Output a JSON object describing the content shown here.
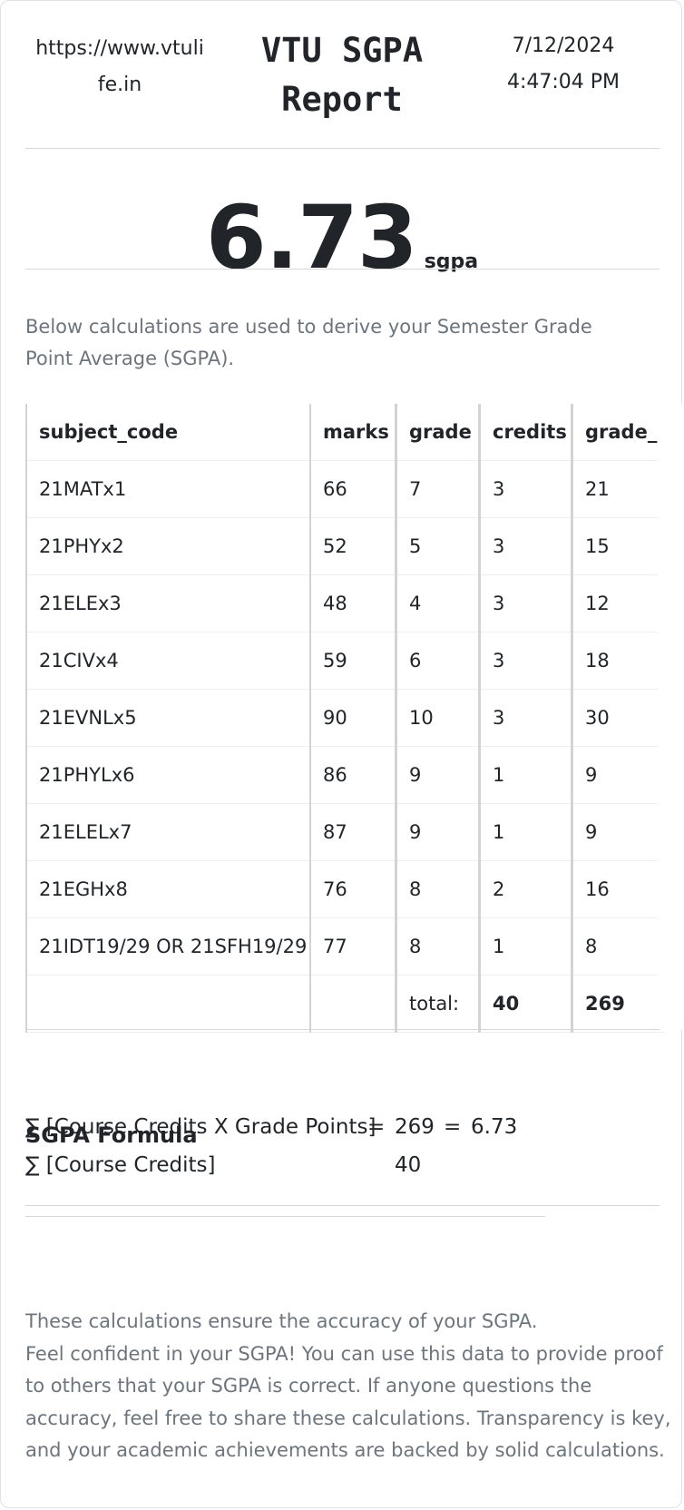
{
  "header": {
    "site_line1": "https://www.vtuli",
    "site_line2": "fe.in",
    "title_line1": "VTU SGPA",
    "title_line2": "Report",
    "date": "7/12/2024",
    "time": "4:47:04 PM"
  },
  "result": {
    "sgpa": "6.73",
    "unit": "sgpa"
  },
  "description": "Below calculations are used to derive your Semester Grade Point Average (SGPA).",
  "table": {
    "headers": [
      "subject_code",
      "marks",
      "grade",
      "credits",
      "grade_x_credits"
    ],
    "rows": [
      [
        "21MATx1",
        "66",
        "7",
        "3",
        "21"
      ],
      [
        "21PHYx2",
        "52",
        "5",
        "3",
        "15"
      ],
      [
        "21ELEx3",
        "48",
        "4",
        "3",
        "12"
      ],
      [
        "21CIVx4",
        "59",
        "6",
        "3",
        "18"
      ],
      [
        "21EVNLx5",
        "90",
        "10",
        "3",
        "30"
      ],
      [
        "21PHYLx6",
        "86",
        "9",
        "1",
        "9"
      ],
      [
        "21ELELx7",
        "87",
        "9",
        "1",
        "9"
      ],
      [
        "21EGHx8",
        "76",
        "8",
        "2",
        "16"
      ],
      [
        "21IDT19/29 OR 21SFH19/29",
        "77",
        "8",
        "1",
        "8"
      ]
    ],
    "total_label": "total:",
    "total_credits": "40",
    "total_points": "269"
  },
  "formula": {
    "title": "SGPA Formula",
    "numerator": "∑ [Course Credits X Grade Points]",
    "equals": "=",
    "numerator_value": "269",
    "result_value": "6.73",
    "denominator": "∑ [Course Credits]",
    "denominator_value": "40"
  },
  "footer": {
    "line1": "These calculations ensure the accuracy of your SGPA.",
    "line2": "Feel confident in your SGPA! You can use this data to provide proof",
    "line3": "to others that your SGPA is correct. If anyone questions the",
    "line4": "accuracy, feel free to share these calculations. Transparency is key,",
    "line5": "and your academic achievements are backed by solid calculations."
  }
}
